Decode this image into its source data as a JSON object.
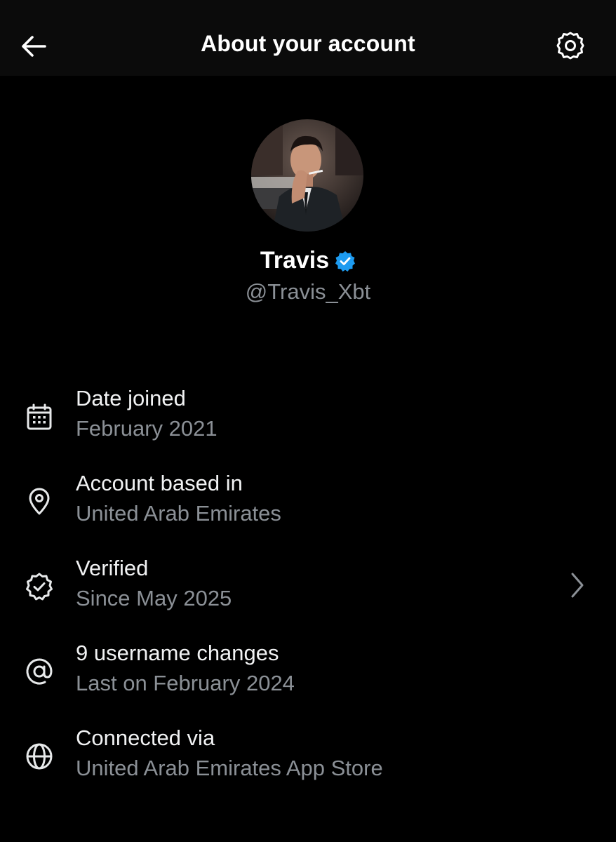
{
  "header": {
    "title": "About your account",
    "back_icon": "arrow-left-icon",
    "settings_icon": "gear-icon"
  },
  "profile": {
    "name": "Travis",
    "handle": "@Travis_Xbt",
    "verified_badge": "verified-badge-icon",
    "avatar": "profile-photo"
  },
  "rows": [
    {
      "icon": "calendar-icon",
      "title": "Date joined",
      "subtitle": "February 2021",
      "has_chevron": false
    },
    {
      "icon": "location-pin-icon",
      "title": "Account based in",
      "subtitle": "United Arab Emirates",
      "has_chevron": false
    },
    {
      "icon": "verified-badge-icon",
      "title": "Verified",
      "subtitle": "Since May 2025",
      "has_chevron": true
    },
    {
      "icon": "at-sign-icon",
      "title": "9 username changes",
      "subtitle": "Last on February 2024",
      "has_chevron": false
    },
    {
      "icon": "globe-icon",
      "title": "Connected via",
      "subtitle": "United Arab Emirates App Store",
      "has_chevron": false
    }
  ],
  "colors": {
    "background": "#000000",
    "header_background": "#0b0b0b",
    "primary_text": "#e7e9ea",
    "secondary_text": "#8b9096",
    "verified_blue": "#1d9bf0"
  }
}
